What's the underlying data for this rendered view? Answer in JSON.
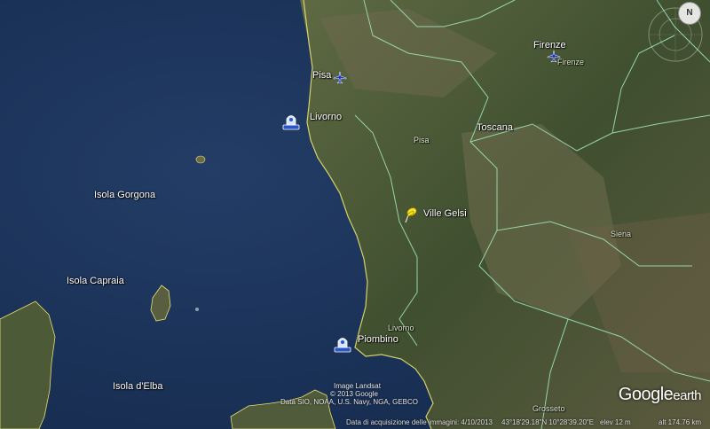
{
  "map": {
    "places": {
      "pisa": "Pisa",
      "firenze": "Firenze",
      "firenze_sub": "Firenze",
      "livorno": "Livorno",
      "toscana": "Toscana",
      "pisa_province": "Pisa",
      "ville_gelsi": "Ville Gelsi",
      "siena": "Siena",
      "isola_gorgona": "Isola Gorgona",
      "isola_capraia": "Isola Capraia",
      "piombino": "Piombino",
      "livorno_province": "Livorno",
      "isola_elba": "Isola d'Elba",
      "grosseto": "Grosseto"
    },
    "icons": {
      "airport": "airplane-icon",
      "port": "port-icon",
      "pushpin": "yellow-pushpin-icon"
    },
    "colors": {
      "sea": "#1c3358",
      "land": "#4a5a36",
      "border": "#9de2b8",
      "coast": "#e8e070",
      "pushpin": "#f5e21a",
      "airport": "#1a34c8"
    }
  },
  "credits": {
    "line1": "Image Landsat",
    "line2": "© 2013 Google",
    "line3": "Data SIO, NOAA, U.S. Navy, NGA, GEBCO"
  },
  "status": {
    "imagery_date": "Data di acquisizione delle immagini: 4/10/2013",
    "coords": "43°18'29.18\"N   10°28'39.20\"E",
    "elev": "elev    12 m",
    "alt": "alt  174.76 km"
  },
  "logo": {
    "google": "Google",
    "earth": "earth"
  },
  "compass": {
    "north": "N"
  }
}
